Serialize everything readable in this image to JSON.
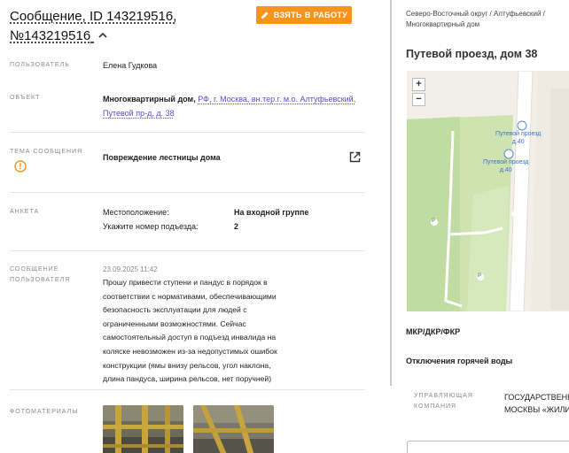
{
  "header": {
    "title_line1": "Сообщение, ID 143219516,",
    "title_line2": "№143219516",
    "take_button": "ВЗЯТЬ В РАБОТУ"
  },
  "fields": {
    "user_label": "ПОЛЬЗОВАТЕЛЬ",
    "user_value": "Елена Гудкова",
    "object_label": "ОБЪЕКТ",
    "object_type": "Многоквартирный дом,",
    "object_address_line1": "РФ, г. Москва, вн.тер.г. м.о. Алтуфьевский,",
    "object_address_line2": "Путевой пр-д, д. 38",
    "topic_label_line1": "ТЕМА СООБЩЕНИЯ",
    "topic_value": "Повреждение лестницы дома",
    "survey_label": "АНКЕТА",
    "survey": [
      {
        "question": "Местоположение:",
        "answer": "На входной группе"
      },
      {
        "question": "Укажите номер подъезда:",
        "answer": "2"
      }
    ],
    "message_label_line1": "СООБЩЕНИЕ",
    "message_label_line2": "ПОЛЬЗОВАТЕЛЯ",
    "message_date": "23.09.2025 11:42",
    "message_lines": [
      "Прошу привести ступени и пандус в порядок в",
      "соответствии с нормативами, обеспечивающими",
      "безопасность эксплуатации для людей с",
      "ограниченными возможностями. Сейчас",
      "самостоятельный доступ в подъезд инвалида на",
      "коляске невозможен из-за недопустимых ошибок",
      "конструкции (ямы внизу рельсов, угол наклона,",
      "длина пандуса, ширина рельсов, нет поручней)"
    ],
    "photos_label": "ФОТОМАТЕРИАЛЫ"
  },
  "right": {
    "breadcrumb_line1": "Северо-Восточный округ / Алтуфьевский /",
    "breadcrumb_line2": "Многоквартирный дом",
    "address_title": "Путевой проезд, дом 38",
    "map": {
      "zoom_in": "+",
      "zoom_out": "−",
      "stop1_line1": "Путевой проезд",
      "stop1_line2": "д.40",
      "stop2_line1": "Путевой проезд",
      "stop2_line2": "д.40",
      "parking": "P"
    },
    "section_mkr": "МКР/ДКР/ФКР",
    "section_hot_water": "Отключения горячей воды",
    "mgmt_label_line1": "УПРАВЛЯЮЩАЯ",
    "mgmt_label_line2": "КОМПАНИЯ",
    "mgmt_value_line1": "ГОСУДАРСТВЕНН",
    "mgmt_value_line2": "МОСКВЫ «ЖИЛИ"
  },
  "colors": {
    "accent_orange": "#f7941e",
    "link_purple": "#5a50b8",
    "warning_orange": "#f7941e"
  }
}
